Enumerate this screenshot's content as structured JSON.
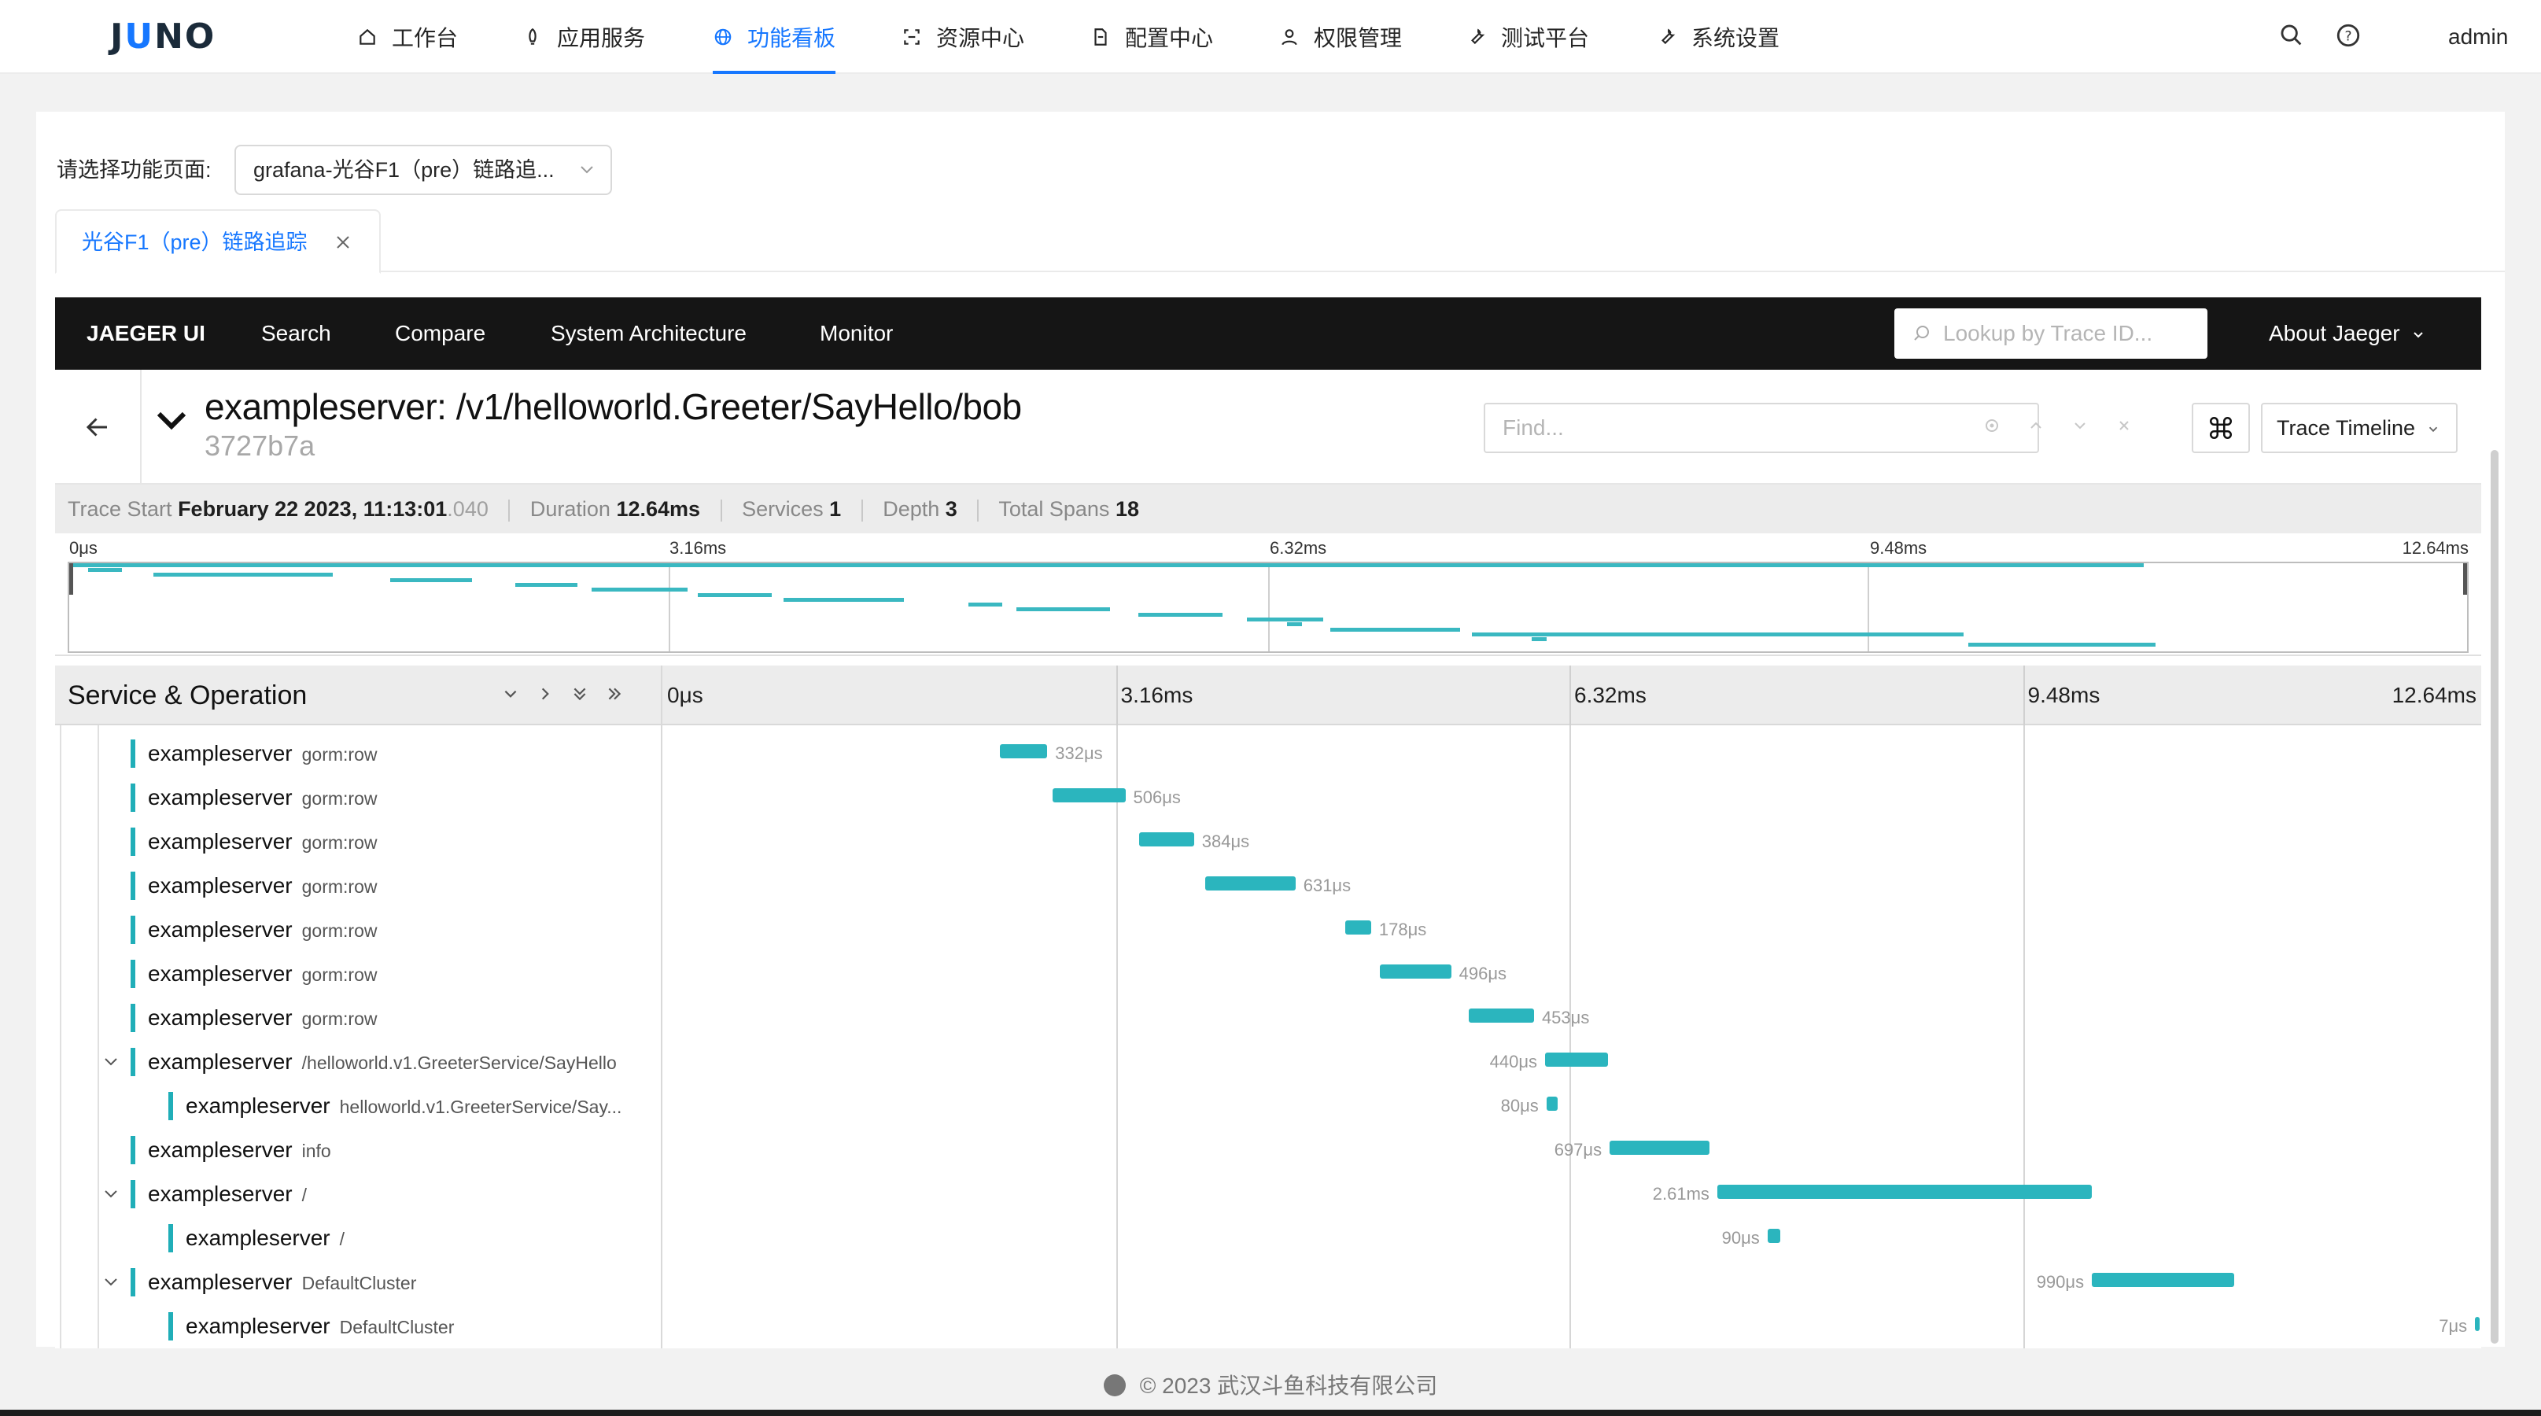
{
  "topnav": {
    "logo": "JUNO",
    "items": [
      {
        "label": "工作台",
        "icon": "home-icon"
      },
      {
        "label": "应用服务",
        "icon": "rocket-icon"
      },
      {
        "label": "功能看板",
        "icon": "globe-icon",
        "active": true
      },
      {
        "label": "资源中心",
        "icon": "scan-icon"
      },
      {
        "label": "配置中心",
        "icon": "file-icon"
      },
      {
        "label": "权限管理",
        "icon": "user-icon"
      },
      {
        "label": "测试平台",
        "icon": "tool-icon"
      },
      {
        "label": "系统设置",
        "icon": "wrench-icon"
      }
    ],
    "user": "admin",
    "accent": "#1677ff"
  },
  "page": {
    "select_label": "请选择功能页面:",
    "select_value": "grafana-光谷F1（pre）链路追...",
    "tab_label": "光谷F1（pre）链路追踪",
    "tab_close": "X"
  },
  "jaeger": {
    "nav": {
      "brand": "JAEGER UI",
      "search": "Search",
      "compare": "Compare",
      "system_architecture": "System Architecture",
      "monitor": "Monitor",
      "lookup_placeholder": "Lookup by Trace ID...",
      "about": "About Jaeger"
    },
    "trace": {
      "title": "exampleserver: /v1/helloworld.Greeter/SayHello/bob",
      "id": "3727b7a",
      "find_placeholder": "Find...",
      "view_mode": "Trace Timeline"
    },
    "stats": {
      "trace_start_label": "Trace Start",
      "trace_start_value": "February 22 2023, 11:13:01",
      "trace_start_ms": ".040",
      "duration_label": "Duration",
      "duration_value": "12.64ms",
      "services_label": "Services",
      "services_value": "1",
      "depth_label": "Depth",
      "depth_value": "3",
      "total_spans_label": "Total Spans",
      "total_spans_value": "18"
    },
    "ticks": [
      "0μs",
      "3.16ms",
      "6.32ms",
      "9.48ms",
      "12.64ms"
    ],
    "column_header": "Service & Operation",
    "bar_color": "#2bb5be",
    "total_ms": 12.64,
    "spans": [
      {
        "service": "exampleserver",
        "op": "gorm:row",
        "start_ms": 2.35,
        "dur_ms": 0.332,
        "dur": "332μs",
        "depth": 1,
        "label_side": "right",
        "toggle": false
      },
      {
        "service": "exampleserver",
        "op": "gorm:row",
        "start_ms": 2.72,
        "dur_ms": 0.506,
        "dur": "506μs",
        "depth": 1,
        "label_side": "right",
        "toggle": false
      },
      {
        "service": "exampleserver",
        "op": "gorm:row",
        "start_ms": 3.32,
        "dur_ms": 0.384,
        "dur": "384μs",
        "depth": 1,
        "label_side": "right",
        "toggle": false
      },
      {
        "service": "exampleserver",
        "op": "gorm:row",
        "start_ms": 3.78,
        "dur_ms": 0.631,
        "dur": "631μs",
        "depth": 1,
        "label_side": "right",
        "toggle": false
      },
      {
        "service": "exampleserver",
        "op": "gorm:row",
        "start_ms": 4.76,
        "dur_ms": 0.178,
        "dur": "178μs",
        "depth": 1,
        "label_side": "right",
        "toggle": false
      },
      {
        "service": "exampleserver",
        "op": "gorm:row",
        "start_ms": 5.0,
        "dur_ms": 0.496,
        "dur": "496μs",
        "depth": 1,
        "label_side": "right",
        "toggle": false
      },
      {
        "service": "exampleserver",
        "op": "gorm:row",
        "start_ms": 5.62,
        "dur_ms": 0.453,
        "dur": "453μs",
        "depth": 1,
        "label_side": "right",
        "toggle": false
      },
      {
        "service": "exampleserver",
        "op": "/helloworld.v1.GreeterService/SayHello",
        "start_ms": 6.15,
        "dur_ms": 0.44,
        "dur": "440μs",
        "depth": 1,
        "label_side": "left",
        "toggle": true
      },
      {
        "service": "exampleserver",
        "op": "helloworld.v1.GreeterService/Say...",
        "start_ms": 6.16,
        "dur_ms": 0.08,
        "dur": "80μs",
        "depth": 2,
        "label_side": "left",
        "toggle": false
      },
      {
        "service": "exampleserver",
        "op": "info",
        "start_ms": 6.6,
        "dur_ms": 0.697,
        "dur": "697μs",
        "depth": 1,
        "label_side": "left",
        "toggle": false
      },
      {
        "service": "exampleserver",
        "op": "/",
        "start_ms": 7.35,
        "dur_ms": 2.61,
        "dur": "2.61ms",
        "depth": 1,
        "label_side": "left",
        "toggle": true
      },
      {
        "service": "exampleserver",
        "op": "/",
        "start_ms": 7.7,
        "dur_ms": 0.09,
        "dur": "90μs",
        "depth": 2,
        "label_side": "left",
        "toggle": false
      },
      {
        "service": "exampleserver",
        "op": "DefaultCluster",
        "start_ms": 9.96,
        "dur_ms": 0.99,
        "dur": "990μs",
        "depth": 1,
        "label_side": "left",
        "toggle": true
      },
      {
        "service": "exampleserver",
        "op": "DefaultCluster",
        "start_ms": 12.63,
        "dur_ms": 0.007,
        "dur": "7μs",
        "depth": 2,
        "label_side": "left",
        "toggle": false
      }
    ]
  },
  "footer": "© 2023 武汉斗鱼科技有限公司"
}
